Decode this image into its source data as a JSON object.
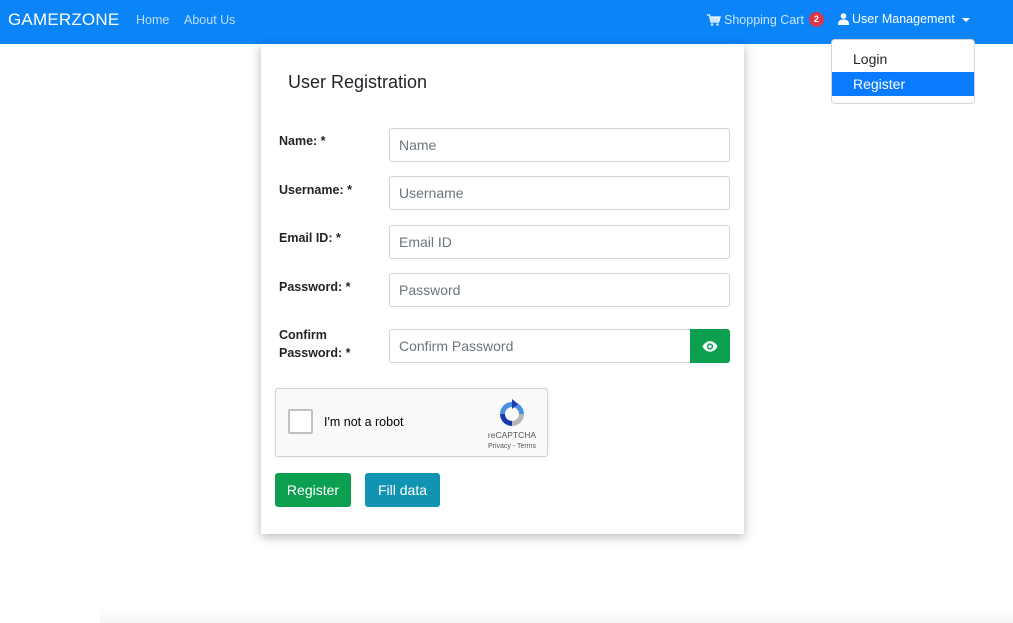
{
  "navbar": {
    "brand": "GAMERZONE",
    "links": [
      "Home",
      "About Us"
    ],
    "cart_label": "Shopping Cart",
    "cart_count": "2",
    "user_menu_label": "User Management",
    "color": "#0a84f7"
  },
  "dropdown": {
    "items": [
      "Login",
      "Register"
    ],
    "active": "Register"
  },
  "form": {
    "title": "User Registration",
    "fields": [
      {
        "label": "Name: *",
        "placeholder": "Name"
      },
      {
        "label": "Username: *",
        "placeholder": "Username"
      },
      {
        "label": "Email ID: *",
        "placeholder": "Email ID"
      },
      {
        "label": "Password: *",
        "placeholder": "Password"
      },
      {
        "label_line1": "Confirm",
        "label_line2": "Password: *",
        "placeholder": "Confirm Password"
      }
    ],
    "toggle_visibility_icon": "eye-icon",
    "captcha": {
      "checkbox_text": "I'm not a robot",
      "brand": "reCAPTCHA",
      "links": "Privacy - Terms"
    },
    "buttons": {
      "register": "Register",
      "fill": "Fill data"
    },
    "colors": {
      "success": "#0b9f4f",
      "info": "#1194b2"
    }
  }
}
